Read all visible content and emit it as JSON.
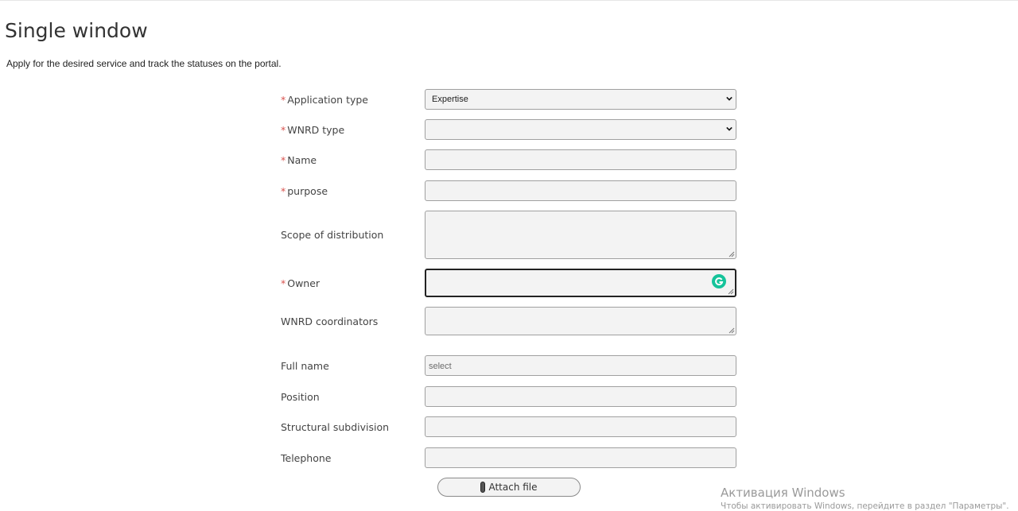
{
  "page": {
    "title": "Single window",
    "subtitle": "Apply for the desired service and track the statuses on the portal."
  },
  "form": {
    "required_mark": "*",
    "application_type": {
      "label": "Application type",
      "value": "Expertise"
    },
    "wnrd_type": {
      "label": "WNRD type",
      "value": ""
    },
    "name": {
      "label": "Name",
      "value": ""
    },
    "purpose": {
      "label": "purpose",
      "value": ""
    },
    "scope": {
      "label": "Scope of distribution",
      "value": ""
    },
    "owner": {
      "label": "Owner",
      "value": ""
    },
    "coordinators": {
      "label": "WNRD coordinators",
      "value": ""
    },
    "full_name": {
      "label": "Full name",
      "placeholder": "select"
    },
    "position": {
      "label": "Position",
      "value": ""
    },
    "subdivision": {
      "label": "Structural subdivision",
      "value": ""
    },
    "telephone": {
      "label": "Telephone",
      "value": ""
    },
    "attach_label": "Attach file"
  },
  "watermark": {
    "title": "Активация Windows",
    "subtitle": "Чтобы активировать Windows, перейдите в раздел \"Параметры\"."
  },
  "colors": {
    "required": "#d9534f",
    "field_bg": "#f3f3f3",
    "field_border": "#a0a0a0",
    "grammarly": "#15c39a"
  },
  "icons": [
    "chevron-down-icon",
    "grammarly-icon",
    "paperclip-icon",
    "resize-grip-icon"
  ]
}
